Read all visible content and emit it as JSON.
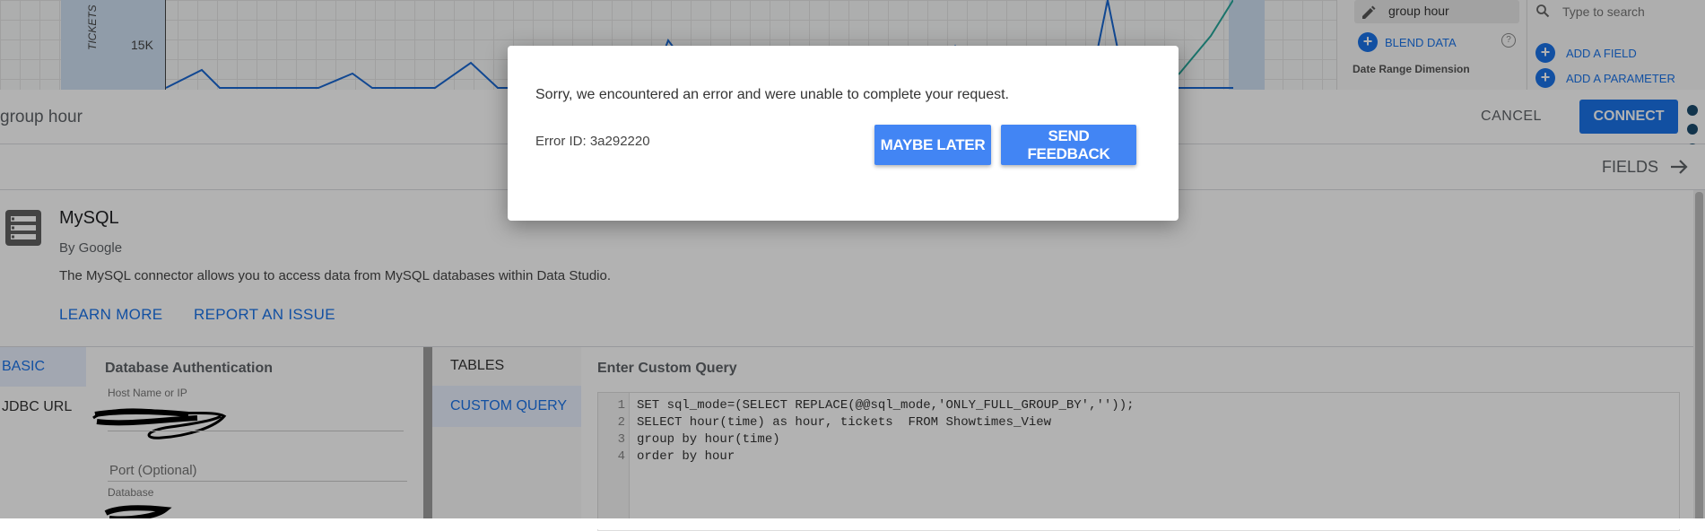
{
  "colors": {
    "accent": "#1a73e8",
    "dialog_button": "#4285f4",
    "overlay": "rgba(0,0,0,0.30)"
  },
  "report": {
    "y_tick": "15K",
    "y_axis_title": "TICKETS",
    "props": {
      "dimension_chip": "group hour",
      "blend_data": "BLEND DATA",
      "help": "?",
      "date_range_label": "Date Range Dimension"
    },
    "fields_panel": {
      "search_placeholder": "Type to search",
      "add_field": "ADD A FIELD",
      "add_parameter": "ADD A PARAMETER"
    }
  },
  "editor": {
    "data_source_name": "group hour",
    "cancel": "CANCEL",
    "connect": "CONNECT",
    "fields_link": "FIELDS"
  },
  "connector": {
    "name": "MySQL",
    "author": "By Google",
    "description": "The MySQL connector allows you to access data from MySQL databases within Data Studio.",
    "learn_more": "LEARN MORE",
    "report_issue": "REPORT AN ISSUE"
  },
  "auth": {
    "nav": [
      "BASIC",
      "JDBC URL"
    ],
    "heading": "Database Authentication",
    "host_label": "Host Name or IP",
    "port_placeholder": "Port (Optional)",
    "database_label": "Database"
  },
  "query": {
    "nav": [
      "TABLES",
      "CUSTOM QUERY"
    ],
    "heading": "Enter Custom Query",
    "line_numbers": [
      "1",
      "2",
      "3",
      "4"
    ],
    "lines": [
      "SET sql_mode=(SELECT REPLACE(@@sql_mode,'ONLY_FULL_GROUP_BY',''));",
      "SELECT hour(time) as hour, tickets  FROM Showtimes_View",
      "group by hour(time)",
      "order by hour"
    ]
  },
  "dialog": {
    "message": "Sorry, we encountered an error and were unable to complete your request.",
    "error_id": "Error ID: 3a292220",
    "maybe_later": "MAYBE LATER",
    "send_feedback": "SEND FEEDBACK"
  }
}
